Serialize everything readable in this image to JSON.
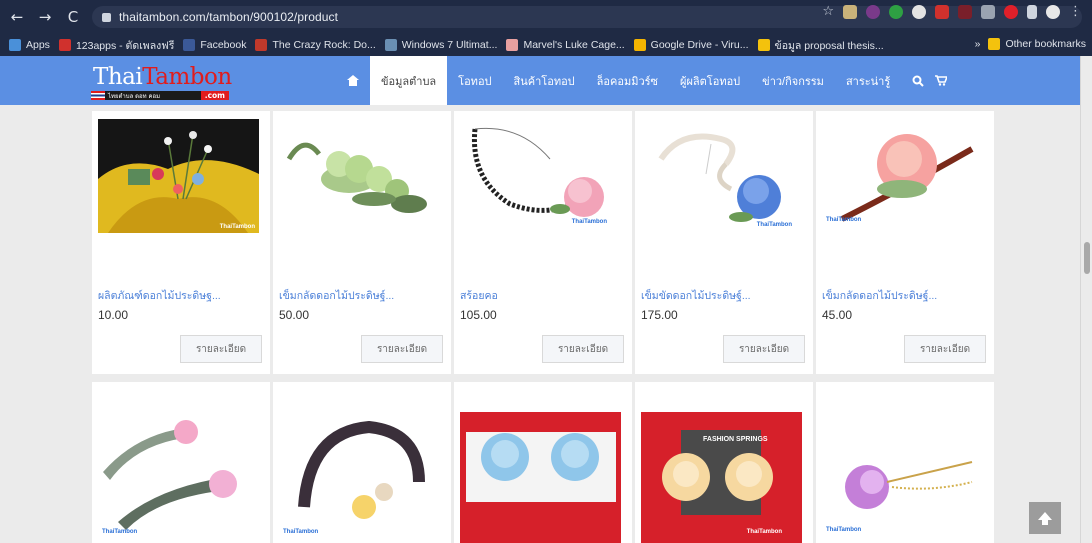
{
  "browser": {
    "url": "thaitambon.com/tambon/900102/product",
    "bookmarks": [
      {
        "label": "Apps",
        "color": "#4a90d9"
      },
      {
        "label": "123apps - ตัดเพลงฟรี",
        "color": "#d0312d"
      },
      {
        "label": "Facebook",
        "color": "#3b5998"
      },
      {
        "label": "The Crazy Rock: Do...",
        "color": "#c0392b"
      },
      {
        "label": "Windows 7 Ultimat...",
        "color": "#6a8fb3"
      },
      {
        "label": "Marvel's Luke Cage...",
        "color": "#e8a0a0"
      },
      {
        "label": "Google Drive - Viru...",
        "color": "#f4b400"
      },
      {
        "label": "ข้อมูล proposal thesis...",
        "color": "#f4c20d"
      }
    ],
    "other_bookmarks": "Other bookmarks",
    "overflow": "»"
  },
  "site": {
    "logo_thai": "Thai",
    "logo_tambon": "Tambon",
    "logo_tagline": "ไทยตำบล ดอท คอม",
    "logo_com": ".com",
    "menu": [
      "ข้อมูลตำบล",
      "โอทอป",
      "สินค้าโอทอป",
      "ล็อคอมมิวร์ซ",
      "ผู้ผลิตโอทอป",
      "ข่าว/กิจกรรม",
      "สาระน่ารู้"
    ]
  },
  "products": [
    {
      "name": "ผลิตภัณฑ์ดอกไม้ประดิษฐ...",
      "price": "10.00",
      "button": "รายละเอียด"
    },
    {
      "name": "เข็มกลัดดอกไม้ประดิษฐ์...",
      "price": "50.00",
      "button": "รายละเอียด"
    },
    {
      "name": "สร้อยคอ",
      "price": "105.00",
      "button": "รายละเอียด"
    },
    {
      "name": "เข็มขัดดอกไม้ประดิษฐ์...",
      "price": "175.00",
      "button": "รายละเอียด"
    },
    {
      "name": "เข็มกลัดดอกไม้ประดิษฐ์...",
      "price": "45.00",
      "button": "รายละเอียด"
    }
  ],
  "watermark": "ThaiTambon",
  "watermark_fashion": "FASHION SPRINGS",
  "colors": {
    "header_bg": "#5b8fe3",
    "link": "#4a7fd8",
    "product_red_bg": "#d6202a"
  }
}
